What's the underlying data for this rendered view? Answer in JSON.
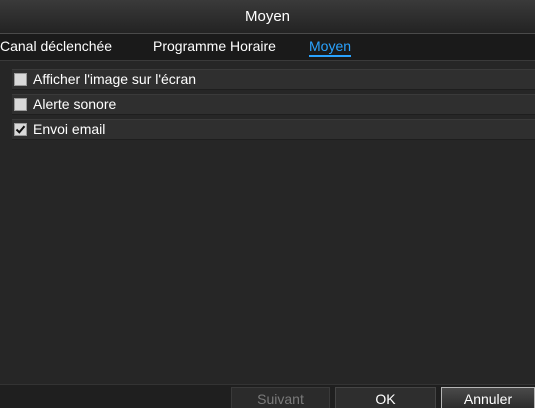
{
  "window": {
    "title": "Moyen"
  },
  "tabs": [
    {
      "label": "Canal déclenchée",
      "active": false
    },
    {
      "label": "Programme Horaire",
      "active": false
    },
    {
      "label": "Moyen",
      "active": true
    }
  ],
  "options": [
    {
      "label": "Afficher l'image sur l'écran",
      "checked": false
    },
    {
      "label": "Alerte sonore",
      "checked": false
    },
    {
      "label": "Envoi email",
      "checked": true
    }
  ],
  "buttons": {
    "next_label": "Suivant",
    "next_enabled": false,
    "ok_label": "OK",
    "cancel_label": "Annuler"
  },
  "colors": {
    "active_tab": "#2aa3ff",
    "background": "#262626"
  }
}
